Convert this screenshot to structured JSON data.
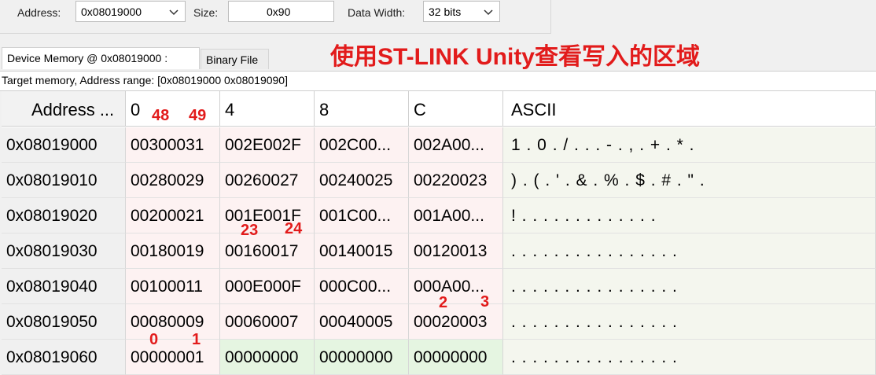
{
  "toolbar": {
    "address_label": "Address:",
    "address_value": "0x08019000",
    "size_label": "Size:",
    "size_value": "0x90",
    "width_label": "Data Width:",
    "width_value": "32 bits"
  },
  "tabs": [
    {
      "label": "Device Memory @ 0x08019000 :"
    },
    {
      "label": "Binary File"
    }
  ],
  "headline": "使用ST-LINK Unity查看写入的区域",
  "range_text": "Target memory, Address range: [0x08019000 0x08019090]",
  "table": {
    "columns": [
      "Address ...",
      "0",
      "4",
      "8",
      "C",
      "ASCII"
    ],
    "rows": [
      {
        "addr": "0x08019000",
        "c0": "00300031",
        "c4": "002E002F",
        "c8": "002C00...",
        "cC": "002A00...",
        "ascii": "1 . 0 . / . . . - . , . + . * ."
      },
      {
        "addr": "0x08019010",
        "c0": "00280029",
        "c4": "00260027",
        "c8": "00240025",
        "cC": "00220023",
        "ascii": ") . ( . ' . & . % . $ . # . \" ."
      },
      {
        "addr": "0x08019020",
        "c0": "00200021",
        "c4": "001E001F",
        "c8": "001C00...",
        "cC": "001A00...",
        "ascii": "! .   . . . . . . . . . . . ."
      },
      {
        "addr": "0x08019030",
        "c0": "00180019",
        "c4": "00160017",
        "c8": "00140015",
        "cC": "00120013",
        "ascii": ". . . . . . . . . . . . . . . ."
      },
      {
        "addr": "0x08019040",
        "c0": "00100011",
        "c4": "000E000F",
        "c8": "000C00...",
        "cC": "000A00...",
        "ascii": ". . . . . . . . . . . . . . . ."
      },
      {
        "addr": "0x08019050",
        "c0": "00080009",
        "c4": "00060007",
        "c8": "00040005",
        "cC": "00020003",
        "ascii": ". . . . . . . . . . . . . . . ."
      },
      {
        "addr": "0x08019060",
        "c0": "00000001",
        "c4": "00000000",
        "c8": "00000000",
        "cC": "00000000",
        "ascii": ". . . . . . . . . . . . . . . ."
      }
    ]
  },
  "annotations": {
    "a48": "48",
    "a49": "49",
    "a23": "23",
    "a24": "24",
    "a2": "2",
    "a3": "3",
    "a0": "0",
    "a1": "1"
  },
  "colors": {
    "annotation": "#e21b1b",
    "hex_cell": "#fdf2f2",
    "changed_cell": "#e5f5e1",
    "address_cell": "#f0f0f0"
  },
  "icons": {
    "dropdown": "chevron-down-icon"
  }
}
